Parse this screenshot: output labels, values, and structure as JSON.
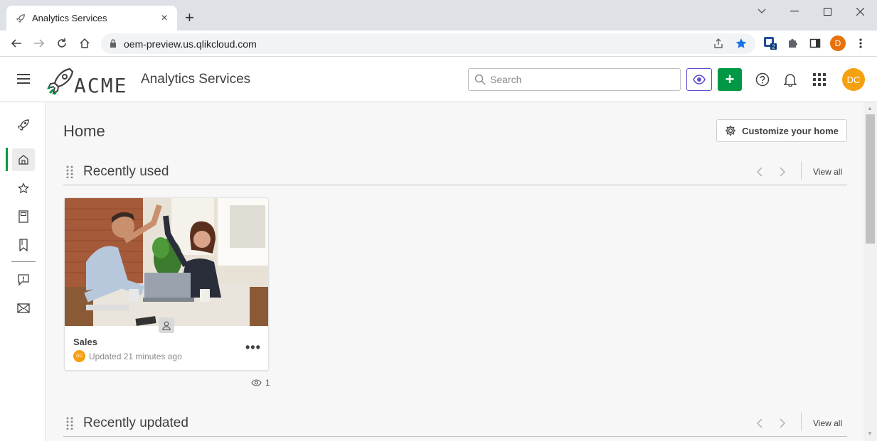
{
  "browser": {
    "tab_title": "Analytics Services",
    "tab_close": "×",
    "new_tab": "+",
    "url_host": "oem-preview.us.qlikcloud.com",
    "profile_initial": "D",
    "extension_badge": "2"
  },
  "header": {
    "logo_text": "ACME",
    "app_title": "Analytics Services",
    "search_placeholder": "Search",
    "create_label": "+",
    "user_initials": "DC",
    "brand_color": "#009845",
    "avatar_color": "#f5a00f"
  },
  "sidebar": {
    "items": [
      {
        "icon": "rocket-icon"
      },
      {
        "icon": "home-icon",
        "active": true
      },
      {
        "icon": "star-icon"
      },
      {
        "icon": "notebook-icon"
      },
      {
        "icon": "bookmark-icon"
      },
      {
        "icon": "feedback-icon"
      },
      {
        "icon": "mail-icon"
      }
    ]
  },
  "main": {
    "page_title": "Home",
    "customize_label": "Customize your home",
    "sections": [
      {
        "title": "Recently used",
        "view_all": "View all"
      },
      {
        "title": "Recently updated",
        "view_all": "View all"
      }
    ],
    "cards": [
      {
        "title": "Sales",
        "owner_initials": "DC",
        "meta": "Updated 21 minutes ago",
        "views": "1",
        "more": "•••"
      }
    ]
  }
}
